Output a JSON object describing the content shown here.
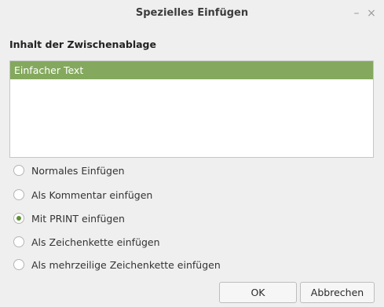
{
  "window": {
    "title": "Spezielles Einfügen",
    "minimize_label": "–",
    "close_label": "×"
  },
  "clipboard": {
    "section_label": "Inhalt der Zwischenablage",
    "items": [
      {
        "label": "Einfacher Text",
        "selected": true
      }
    ]
  },
  "options": [
    {
      "label": "Normales Einfügen",
      "checked": false
    },
    {
      "label": "Als Kommentar einfügen",
      "checked": false
    },
    {
      "label": "Mit PRINT einfügen",
      "checked": true
    },
    {
      "label": "Als Zeichenkette einfügen",
      "checked": false
    },
    {
      "label": "Als mehrzeilige Zeichenkette einfügen",
      "checked": false
    }
  ],
  "buttons": {
    "ok_label": "OK",
    "cancel_label": "Abbrechen"
  },
  "colors": {
    "selection": "#84a95e",
    "radio_checked": "#5f8f35"
  }
}
